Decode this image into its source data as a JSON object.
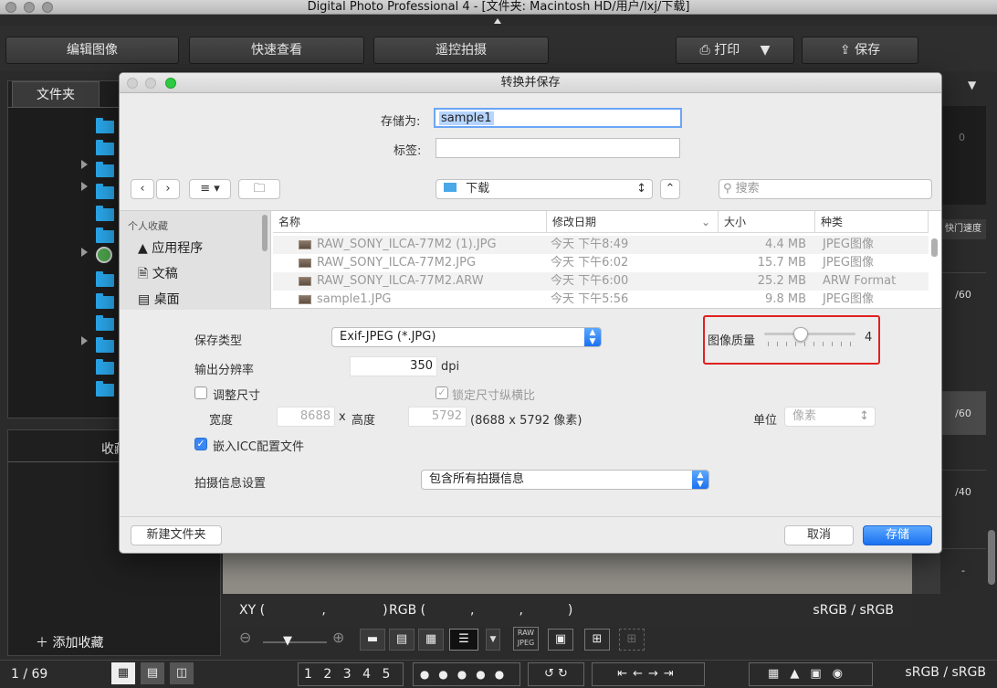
{
  "app": {
    "title": "Digital Photo Professional 4 - [文件夹: Macintosh HD/用户/lxj/下载]"
  },
  "toolbar": {
    "edit_image": "编辑图像",
    "quick_view": "快速查看",
    "remote_shoot": "遥控拍摄",
    "print": "打印",
    "save": "保存"
  },
  "left": {
    "folders_tab": "文件夹",
    "favorites_title": "收藏",
    "add_favorite": "添加收藏"
  },
  "right": {
    "shutter_label": "快门速度",
    "values": [
      "0",
      "/60",
      "/60",
      "/40",
      "-"
    ]
  },
  "status": {
    "page_counter": "1 / 69",
    "ratings": [
      "1",
      "2",
      "3",
      "4",
      "5"
    ],
    "color_space": "sRGB / sRGB"
  },
  "viewer": {
    "xy_label": "XY (              ,              )",
    "rgb_label": "RGB (           ,           ,           )",
    "color_space": "sRGB / sRGB",
    "raw_label": "RAW",
    "jpeg_label": "JPEG"
  },
  "dialog": {
    "title": "转换并保存",
    "save_as_label": "存储为:",
    "save_as_value": "sample1",
    "tags_label": "标签:",
    "location": "下载",
    "search_placeholder": "搜索",
    "sidebar": {
      "section": "个人收藏",
      "items": [
        "应用程序",
        "文稿",
        "桌面"
      ]
    },
    "columns": {
      "name": "名称",
      "modified": "修改日期",
      "size": "大小",
      "kind": "种类"
    },
    "files": [
      {
        "name": "RAW_SONY_ILCA-77M2 (1).JPG",
        "date": "今天 下午8:49",
        "size": "4.4 MB",
        "kind": "JPEG图像"
      },
      {
        "name": "RAW_SONY_ILCA-77M2.JPG",
        "date": "今天 下午6:02",
        "size": "15.7 MB",
        "kind": "JPEG图像"
      },
      {
        "name": "RAW_SONY_ILCA-77M2.ARW",
        "date": "今天 下午6:00",
        "size": "25.2 MB",
        "kind": "ARW Format"
      },
      {
        "name": "sample1.JPG",
        "date": "今天 下午5:56",
        "size": "9.8 MB",
        "kind": "JPEG图像"
      }
    ],
    "options": {
      "save_type_label": "保存类型",
      "save_type_value": "Exif-JPEG (*.JPG)",
      "quality_label": "图像质量",
      "quality_value": "4",
      "quality_fraction": 0.4,
      "resolution_label": "输出分辨率",
      "resolution_value": "350",
      "resolution_unit": "dpi",
      "resize_label": "调整尺寸",
      "lock_ratio_label": "锁定尺寸纵横比",
      "width_label": "宽度",
      "width_value": "8688",
      "x_sep": "x",
      "height_label": "高度",
      "height_value": "5792",
      "pixels_note": "(8688 x 5792 像素)",
      "unit_label": "单位",
      "unit_value": "像素",
      "embed_icc_label": "嵌入ICC配置文件",
      "shot_info_label": "拍摄信息设置",
      "shot_info_value": "包含所有拍摄信息"
    },
    "new_folder": "新建文件夹",
    "cancel": "取消",
    "save": "存储"
  },
  "colors": {
    "accent": "#1b71f0",
    "highlight": "#e02020",
    "folder": "#29a5e8"
  }
}
